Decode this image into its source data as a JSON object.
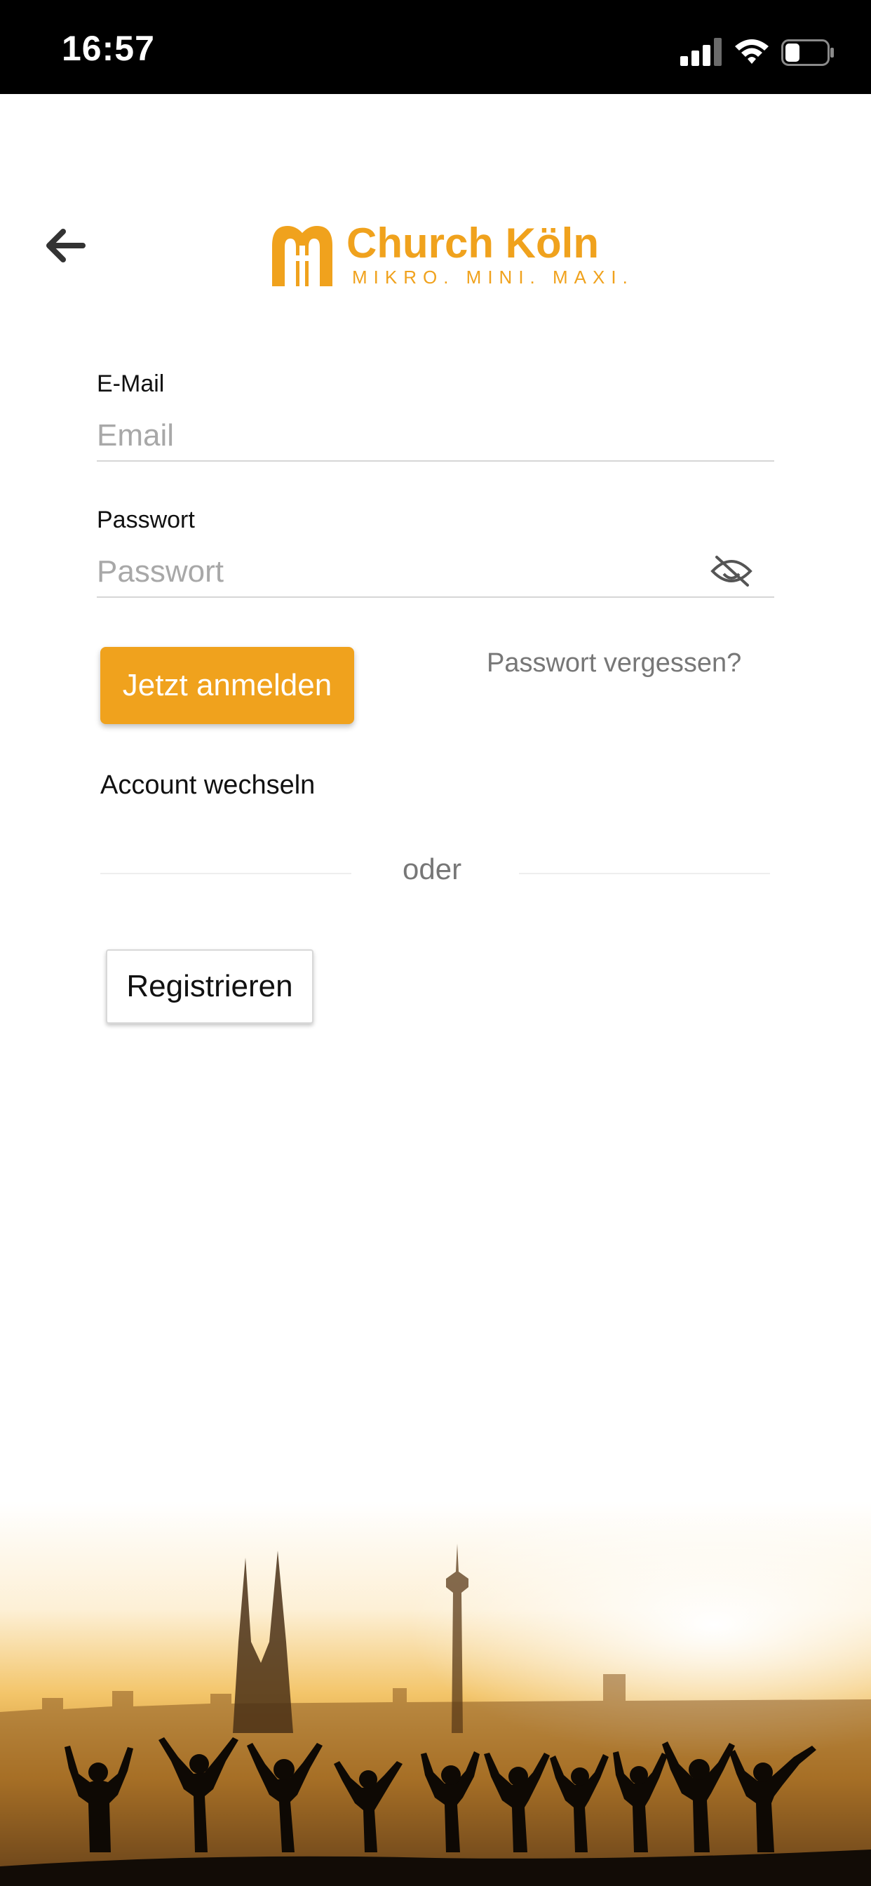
{
  "status_bar": {
    "time": "16:57",
    "signal_icon": "cellular-signal-icon",
    "wifi_icon": "wifi-icon",
    "battery_icon": "battery-icon",
    "battery_level": 0.35
  },
  "header": {
    "back_icon": "arrow-left-icon",
    "logo": {
      "name": "Church Köln",
      "tagline": "MIKRO. MINI. MAXI.",
      "color": "#f0a21d"
    }
  },
  "form": {
    "email_label": "E-Mail",
    "email_placeholder": "Email",
    "email_value": "",
    "password_label": "Passwort",
    "password_placeholder": "Passwort",
    "password_value": "",
    "password_toggle_icon": "eye-slash-icon",
    "login_button": "Jetzt anmelden",
    "forgot_password": "Passwort vergessen?",
    "switch_account": "Account wechseln",
    "divider_text": "oder",
    "register_button": "Registrieren"
  },
  "colors": {
    "accent": "#f0a21d",
    "status_bar_bg": "#000000",
    "background": "#ffffff"
  },
  "hero_image": "cologne-skyline-silhouette-people-image"
}
